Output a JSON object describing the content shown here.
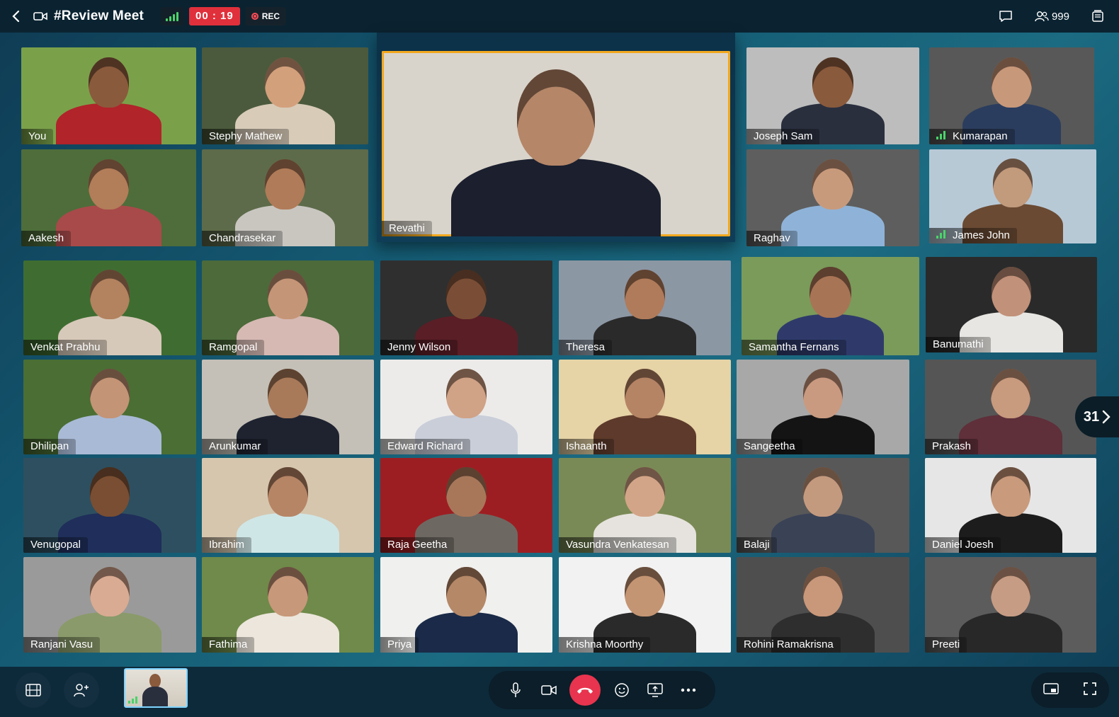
{
  "header": {
    "title": "#Review Meet",
    "timer": "00 : 19",
    "rec_label": "REC",
    "participant_count": "999",
    "icons": [
      "back-arrow-icon",
      "video-camera-icon",
      "signal-icon",
      "record-icon",
      "chat-icon",
      "participants-icon",
      "notes-icon"
    ]
  },
  "participants": [
    {
      "name": "You",
      "bg": "#7aa14a",
      "skin": "#8a5a3c",
      "shirt": "#b0242a"
    },
    {
      "name": "Stephy Mathew",
      "bg": "#4b5a3c",
      "skin": "#d3a07c",
      "shirt": "#d8cbb8"
    },
    {
      "name": "Aakesh",
      "bg": "#4e6d3a",
      "skin": "#b27d59",
      "shirt": "#a84a4a"
    },
    {
      "name": "Chandrasekar",
      "bg": "#5d6b4a",
      "skin": "#b07b58",
      "shirt": "#c9c6c0"
    },
    {
      "name": "Revathi",
      "bg": "#d9d4cb",
      "skin": "#b58668",
      "shirt": "#1b1f2e"
    },
    {
      "name": "Joseph Sam",
      "bg": "#bdbdbd",
      "skin": "#8a5a3c",
      "shirt": "#2a2f3e"
    },
    {
      "name": "Kumarapan",
      "bg": "#585858",
      "skin": "#c8987a",
      "shirt": "#2b3d5e"
    },
    {
      "name": "Raghav",
      "bg": "#5e5e5e",
      "skin": "#c89a7c",
      "shirt": "#8fb3d8"
    },
    {
      "name": "James John",
      "bg": "#b8c9d6",
      "skin": "#c29a7c",
      "shirt": "#6a4a33"
    },
    {
      "name": "Venkat Prabhu",
      "bg": "#3f6d31",
      "skin": "#b3825f",
      "shirt": "#d7c9b9"
    },
    {
      "name": "Ramgopal",
      "bg": "#4c6a3a",
      "skin": "#c59577",
      "shirt": "#d6b9b3"
    },
    {
      "name": "Jenny Wilson",
      "bg": "#2f2f2f",
      "skin": "#7a4e36",
      "shirt": "#5a1e26"
    },
    {
      "name": "Theresa",
      "bg": "#8c97a4",
      "skin": "#b07b5a",
      "shirt": "#2a2a2a"
    },
    {
      "name": "Samantha Fernans",
      "bg": "#7a9b5a",
      "skin": "#a87456",
      "shirt": "#2f3a6b"
    },
    {
      "name": "Banumathi",
      "bg": "#2a2a2a",
      "skin": "#c2917a",
      "shirt": "#e8e6e2"
    },
    {
      "name": "Dhilipan",
      "bg": "#4a6e34",
      "skin": "#c39476",
      "shirt": "#a9bad6"
    },
    {
      "name": "Arunkumar",
      "bg": "#c4c0b7",
      "skin": "#a87a5a",
      "shirt": "#1f2330"
    },
    {
      "name": "Edward Richard",
      "bg": "#ecebea",
      "skin": "#d0a286",
      "shirt": "#c9ced9"
    },
    {
      "name": "Ishaanth",
      "bg": "#e6d3a6",
      "skin": "#b58465",
      "shirt": "#5d3a2b"
    },
    {
      "name": "Sangeetha",
      "bg": "#a8a8a8",
      "skin": "#c99a80",
      "shirt": "#141414"
    },
    {
      "name": "Prakash",
      "bg": "#555555",
      "skin": "#c89a7e",
      "shirt": "#5f2f3a"
    },
    {
      "name": "Venugopal",
      "bg": "#2e4f60",
      "skin": "#7a4e32",
      "shirt": "#1f2e5a"
    },
    {
      "name": "Ibrahim",
      "bg": "#d6c6ae",
      "skin": "#b68566",
      "shirt": "#cfe6e6"
    },
    {
      "name": "Raja Geetha",
      "bg": "#9d1e22",
      "skin": "#a8775a",
      "shirt": "#6e6862"
    },
    {
      "name": "Vasundra Venkatesan",
      "bg": "#7a8a56",
      "skin": "#d3a588",
      "shirt": "#e6e3de"
    },
    {
      "name": "Balaji",
      "bg": "#585858",
      "skin": "#c49a7f",
      "shirt": "#3a4256"
    },
    {
      "name": "Daniel Joesh",
      "bg": "#e6e6e6",
      "skin": "#c99a7c",
      "shirt": "#1c1c1c"
    },
    {
      "name": "Ranjani Vasu",
      "bg": "#9a9a9a",
      "skin": "#d9ab92",
      "shirt": "#8a9a6a"
    },
    {
      "name": "Fathima",
      "bg": "#6f8a4a",
      "skin": "#c7987a",
      "shirt": "#ece6dc"
    },
    {
      "name": "Priya",
      "bg": "#f0f0ee",
      "skin": "#b58868",
      "shirt": "#1a2a48"
    },
    {
      "name": "Krishna Moorthy",
      "bg": "#f2f2f2",
      "skin": "#c49573",
      "shirt": "#2a2a2a"
    },
    {
      "name": "Rohini Ramakrisna",
      "bg": "#4e4e4e",
      "skin": "#c9977a",
      "shirt": "#2e2e2e"
    },
    {
      "name": "Preeti",
      "bg": "#5c5c5c",
      "skin": "#c79c84",
      "shirt": "#282828"
    }
  ],
  "pager": {
    "count": "31"
  },
  "toolbar": {
    "left_buttons": [
      "grid-view-icon",
      "add-participant-icon"
    ],
    "controls": [
      "microphone-icon",
      "video-icon",
      "end-call-icon",
      "emoji-icon",
      "screen-share-icon",
      "more-icon"
    ],
    "right_buttons": [
      "picture-in-picture-icon",
      "fullscreen-icon"
    ]
  },
  "colors": {
    "accent": "#f2a81d",
    "end_call": "#e8344e",
    "signal": "#4bd36b",
    "timer": "#e0303b"
  }
}
